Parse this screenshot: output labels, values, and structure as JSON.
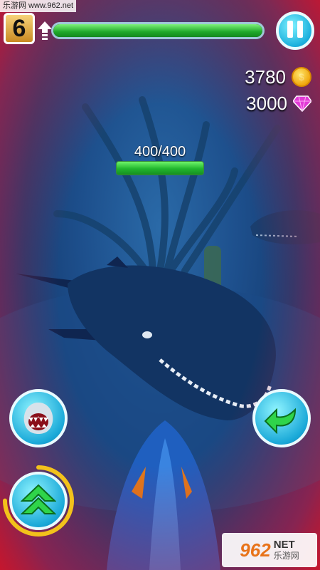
{
  "watermark_top": "乐游网 www.962.net",
  "hud": {
    "level": "6",
    "xp_fraction": 1.0,
    "coins": "3780",
    "gems": "3000",
    "coin_icon": "coin-icon",
    "gem_icon": "gem-icon"
  },
  "enemy": {
    "hp_text": "400/400",
    "hp_fraction": 1.0
  },
  "controls": {
    "pause": "pause-icon",
    "bite": "shark-jaws-icon",
    "turn": "turn-back-arrow-icon",
    "boost": "double-up-arrow-icon",
    "boost_ring_fraction": 0.75
  },
  "watermark_bottom": {
    "number": "962",
    "net": "NET",
    "cn": "乐游网"
  },
  "colors": {
    "hp_green": "#21b62d",
    "button_blue": "#1aa9d8",
    "danger_vignette": "#dc1428"
  }
}
